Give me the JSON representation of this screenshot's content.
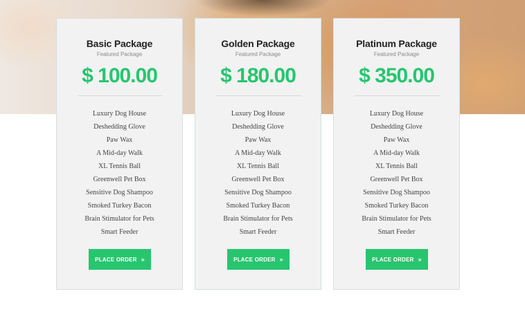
{
  "packages": [
    {
      "title": "Basic Package",
      "subtitle": "Featured Package",
      "price": "$ 100.00",
      "features": [
        "Luxury Dog House",
        "Deshedding Glove",
        "Paw Wax",
        "A Mid-day Walk",
        "XL Tennis Ball",
        "Greenwell Pet Box",
        "Sensitive Dog Shampoo",
        "Smoked Turkey Bacon",
        "Brain Stimulator for Pets",
        "Smart Feeder"
      ],
      "button": "PLACE ORDER",
      "button_icon": "double-chevron-right-icon"
    },
    {
      "title": "Golden Package",
      "subtitle": "Featured Package",
      "price": "$ 180.00",
      "features": [
        "Luxury Dog House",
        "Deshedding Glove",
        "Paw Wax",
        "A Mid-day Walk",
        "XL Tennis Ball",
        "Greenwell Pet Box",
        "Sensitive Dog Shampoo",
        "Smoked Turkey Bacon",
        "Brain Stimulator for Pets",
        "Smart Feeder"
      ],
      "button": "PLACE ORDER",
      "button_icon": "double-chevron-right-icon"
    },
    {
      "title": "Platinum Package",
      "subtitle": "Featured Package",
      "price": "$ 350.00",
      "features": [
        "Luxury Dog House",
        "Deshedding Glove",
        "Paw Wax",
        "A Mid-day Walk",
        "XL Tennis Ball",
        "Greenwell Pet Box",
        "Sensitive Dog Shampoo",
        "Smoked Turkey Bacon",
        "Brain Stimulator for Pets",
        "Smart Feeder"
      ],
      "button": "PLACE ORDER",
      "button_icon": "double-chevron-right-icon"
    }
  ],
  "colors": {
    "accent": "#28c56f",
    "card_bg": "#f2f2f2",
    "title": "#222222"
  }
}
